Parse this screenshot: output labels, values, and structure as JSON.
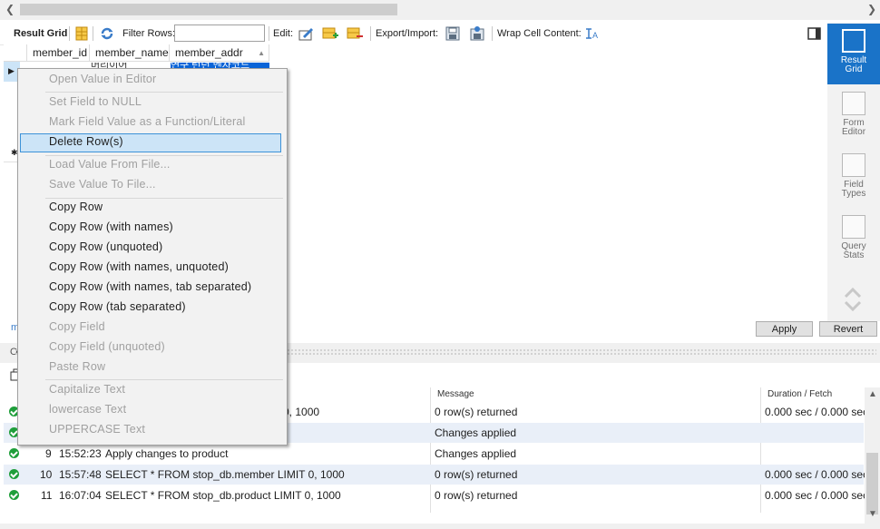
{
  "toolbar": {
    "result_grid": "Result Grid",
    "filter_rows": "Filter Rows:",
    "filter_value": "",
    "edit": "Edit:",
    "export_import": "Export/Import:",
    "wrap_cell": "Wrap Cell Content:"
  },
  "grid": {
    "columns": [
      "member_id",
      "member_name",
      "member_addr"
    ],
    "row1": {
      "member_name": "머리이어",
      "member_addr": "연구 런던 멘자코드"
    }
  },
  "sidebar": {
    "items": [
      {
        "label1": "Result",
        "label2": "Grid",
        "active": true
      },
      {
        "label1": "Form",
        "label2": "Editor",
        "active": false
      },
      {
        "label1": "Field",
        "label2": "Types",
        "active": false
      },
      {
        "label1": "Query",
        "label2": "Stats",
        "active": false
      }
    ]
  },
  "buttons": {
    "apply": "Apply",
    "revert": "Revert"
  },
  "output": {
    "columns": {
      "message": "Message",
      "duration": "Duration / Fetch"
    },
    "rows": [
      {
        "idx": "",
        "time": "",
        "action": "0, 1000",
        "message": "0 row(s) returned",
        "duration": "0.000 sec / 0.000 sec"
      },
      {
        "idx": "",
        "time": "",
        "action": "",
        "message": "Changes applied",
        "duration": ""
      },
      {
        "idx": "9",
        "time": "15:52:23",
        "action": "Apply changes to product",
        "message": "Changes applied",
        "duration": ""
      },
      {
        "idx": "10",
        "time": "15:57:48",
        "action": "SELECT * FROM stop_db.member LIMIT 0, 1000",
        "message": "0 row(s) returned",
        "duration": "0.000 sec / 0.000 sec"
      },
      {
        "idx": "11",
        "time": "16:07:04",
        "action": "SELECT * FROM stop_db.product LIMIT 0, 1000",
        "message": "0 row(s) returned",
        "duration": "0.000 sec / 0.000 sec"
      }
    ]
  },
  "menu": {
    "items": [
      {
        "label": "Open Value in Editor",
        "enabled": false
      },
      {
        "label": "Set Field to NULL",
        "enabled": false
      },
      {
        "label": "Mark Field Value as a Function/Literal",
        "enabled": false
      },
      {
        "label": "Delete Row(s)",
        "enabled": true
      },
      {
        "label": "Load Value From File...",
        "enabled": false
      },
      {
        "label": "Save Value To File...",
        "enabled": false
      },
      {
        "label": "Copy Row",
        "enabled": true
      },
      {
        "label": "Copy Row (with names)",
        "enabled": true
      },
      {
        "label": "Copy Row (unquoted)",
        "enabled": true
      },
      {
        "label": "Copy Row (with names, unquoted)",
        "enabled": true
      },
      {
        "label": "Copy Row (with names, tab separated)",
        "enabled": true
      },
      {
        "label": "Copy Row (tab separated)",
        "enabled": true
      },
      {
        "label": "Copy Field",
        "enabled": false
      },
      {
        "label": "Copy Field (unquoted)",
        "enabled": false
      },
      {
        "label": "Paste Row",
        "enabled": false
      },
      {
        "label": "Capitalize Text",
        "enabled": false
      },
      {
        "label": "lowercase Text",
        "enabled": false
      },
      {
        "label": "UPPERCASE Text",
        "enabled": false
      }
    ]
  },
  "colors": {
    "accent": "#1a73c8",
    "ok": "#1e9e3a",
    "menu_highlight": "#cce4f7"
  }
}
